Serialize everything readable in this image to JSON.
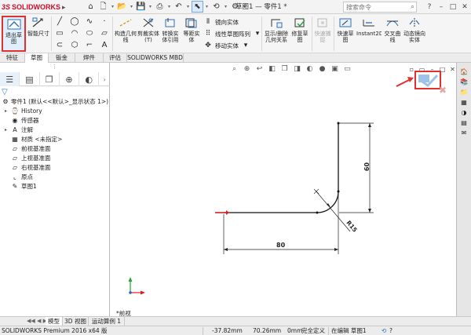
{
  "app": {
    "brand_prefix": "3S",
    "brand": "SOLIDWORKS",
    "document_title": "草图1 — 零件1 *",
    "search_placeholder": "搜索命令"
  },
  "colors": {
    "accent": "#1f6fc5",
    "brand_red": "#c8102e",
    "highlight_red": "#e03030",
    "origin_red": "#d42020",
    "origin_blue": "#1e5fd0",
    "origin_green": "#26a33a"
  },
  "ribbon": {
    "exit_sketch": "退出草图",
    "smart_dimension": "智能尺寸",
    "trim_entities": "剪裁实体(T)",
    "convert_entities": "转换实体引用",
    "offset_entities": "等距实体",
    "construction_geometry": "构造几何线",
    "mirror_entities": "镜向实体",
    "linear_pattern": "线性草图阵列",
    "move_entities": "移动实体",
    "display_relations": "显示/删除几何关系",
    "repair_sketch": "修复草图",
    "quick_snaps": "快速捕捉",
    "rapid_sketch": "快速草图",
    "instant2d": "Instant2D",
    "intersection_curve": "交叉曲线",
    "dynamic_mirror": "动态镜向实体"
  },
  "tabs": [
    "特征",
    "草图",
    "钣金",
    "焊件",
    "评估",
    "SOLIDWORKS MBD"
  ],
  "tree": {
    "part": "零件1 (默认<<默认>_显示状态 1>)",
    "items": [
      "History",
      "传感器",
      "注解",
      "材质 <未指定>",
      "前视基准面",
      "上视基准面",
      "右视基准面",
      "原点",
      "草图1"
    ]
  },
  "graphics": {
    "view_name": "*前视",
    "dim_horizontal": "80",
    "dim_vertical": "60",
    "dim_radius": "R15"
  },
  "bottom_tabs": [
    "模型",
    "3D 视图",
    "运动算例 1"
  ],
  "status": {
    "product": "SOLIDWORKS Premium 2016 x64 版",
    "x": "-37.82mm",
    "y": "70.26mm",
    "z": "0mm",
    "definition": "完全定义",
    "editing": "在编辑 草图1"
  },
  "icons": [
    "undo-icon",
    "redo-icon",
    "new-file-icon",
    "open-icon",
    "save-icon",
    "print-icon",
    "select-cursor-icon",
    "rebuild-icon",
    "options-icon",
    "line-icon",
    "rectangle-icon",
    "circle-icon",
    "arc-icon",
    "spline-icon",
    "slot-icon",
    "polygon-icon",
    "ellipse-icon",
    "fillet-icon",
    "point-icon",
    "text-icon",
    "plane-icon",
    "confirm-check-icon",
    "cancel-x-icon",
    "zoom-fit-icon",
    "section-view-icon",
    "view-orientation-icon",
    "display-style-icon",
    "appearance-icon",
    "scene-icon"
  ]
}
